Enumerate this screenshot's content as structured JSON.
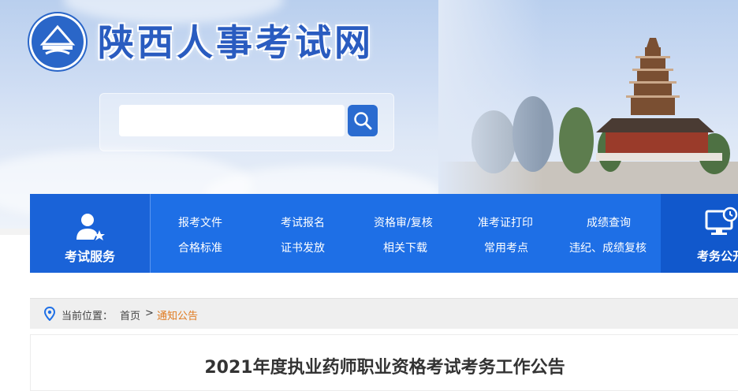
{
  "site": {
    "title": "陕西人事考试网"
  },
  "search": {
    "placeholder": ""
  },
  "nav": {
    "left_label": "考试服务",
    "links": [
      [
        "报考文件",
        "考试报名",
        "资格审/复核",
        "准考证打印",
        "成绩查询"
      ],
      [
        "合格标准",
        "证书发放",
        "相关下载",
        "常用考点",
        "违纪、成绩复核"
      ]
    ],
    "right_label": "考务公开"
  },
  "breadcrumb": {
    "label": "当前位置：",
    "home": "首页",
    "sep": ">",
    "current": "通知公告"
  },
  "article": {
    "title": "2021年度执业药师职业资格考试考务工作公告"
  },
  "colors": {
    "nav_blue": "#1e6fe6",
    "title_blue": "#2a5cc0",
    "crumb_current": "#e07a1f"
  }
}
